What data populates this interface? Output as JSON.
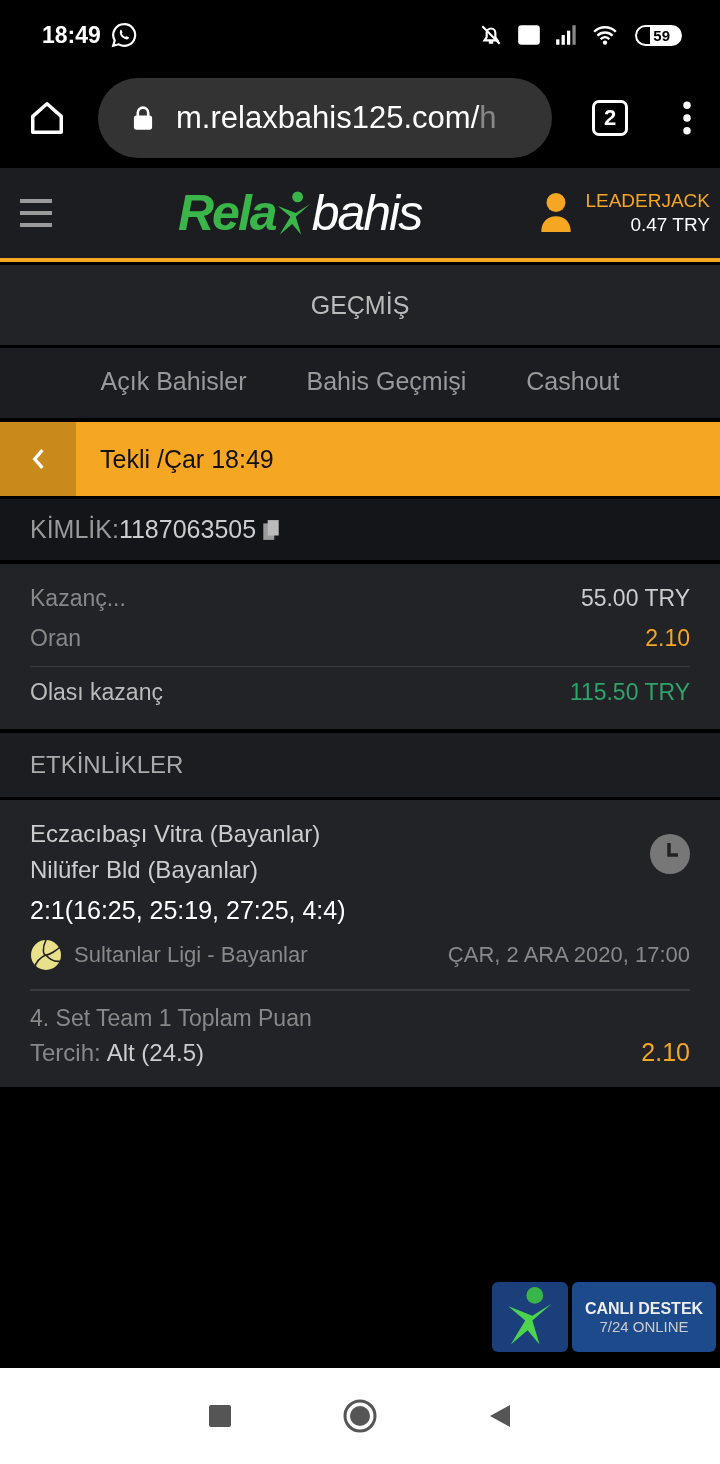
{
  "status_bar": {
    "time": "18:49",
    "battery": "59"
  },
  "browser": {
    "url": "m.relaxbahis125.com/",
    "url_faded": "h",
    "tab_count": "2"
  },
  "header": {
    "logo_left": "Rela",
    "logo_right": "bahis",
    "username": "LEADERJACK",
    "balance": "0.47 TRY"
  },
  "page_title": "GEÇMİŞ",
  "tabs": [
    {
      "label": "Açık Bahisler",
      "selected": false
    },
    {
      "label": "Bahis Geçmişi",
      "selected": false
    },
    {
      "label": "Cashout",
      "selected": false
    }
  ],
  "bet_bar": {
    "title": "Tekli /Çar 18:49"
  },
  "id_row": {
    "label": "KİMLİK:",
    "value": "1187063505"
  },
  "summary": [
    {
      "label": "Kazanç...",
      "value": "55.00 TRY",
      "kind": "plain"
    },
    {
      "label": "Oran",
      "value": "2.10",
      "kind": "odds"
    },
    {
      "label": "Olası kazanç",
      "value": "115.50 TRY",
      "kind": "win"
    }
  ],
  "events_heading": "ETKİNLİKLER",
  "event": {
    "team_1": "Eczacıbaşı Vitra (Bayanlar)",
    "team_2": "Nilüfer Bld (Bayanlar)",
    "score": "2:1(16:25, 25:19, 27:25, 4:4)",
    "league": "Sultanlar Ligi - Bayanlar",
    "date": "ÇAR, 2 ARA 2020, 17:00",
    "market": "4. Set Team 1 Toplam Puan",
    "choice_label": "Tercih:",
    "choice": "Alt (24.5)",
    "odds": "2.10"
  },
  "support_badge": {
    "line_1": "CANLI DESTEK",
    "line_2": "7/24 ONLINE"
  }
}
